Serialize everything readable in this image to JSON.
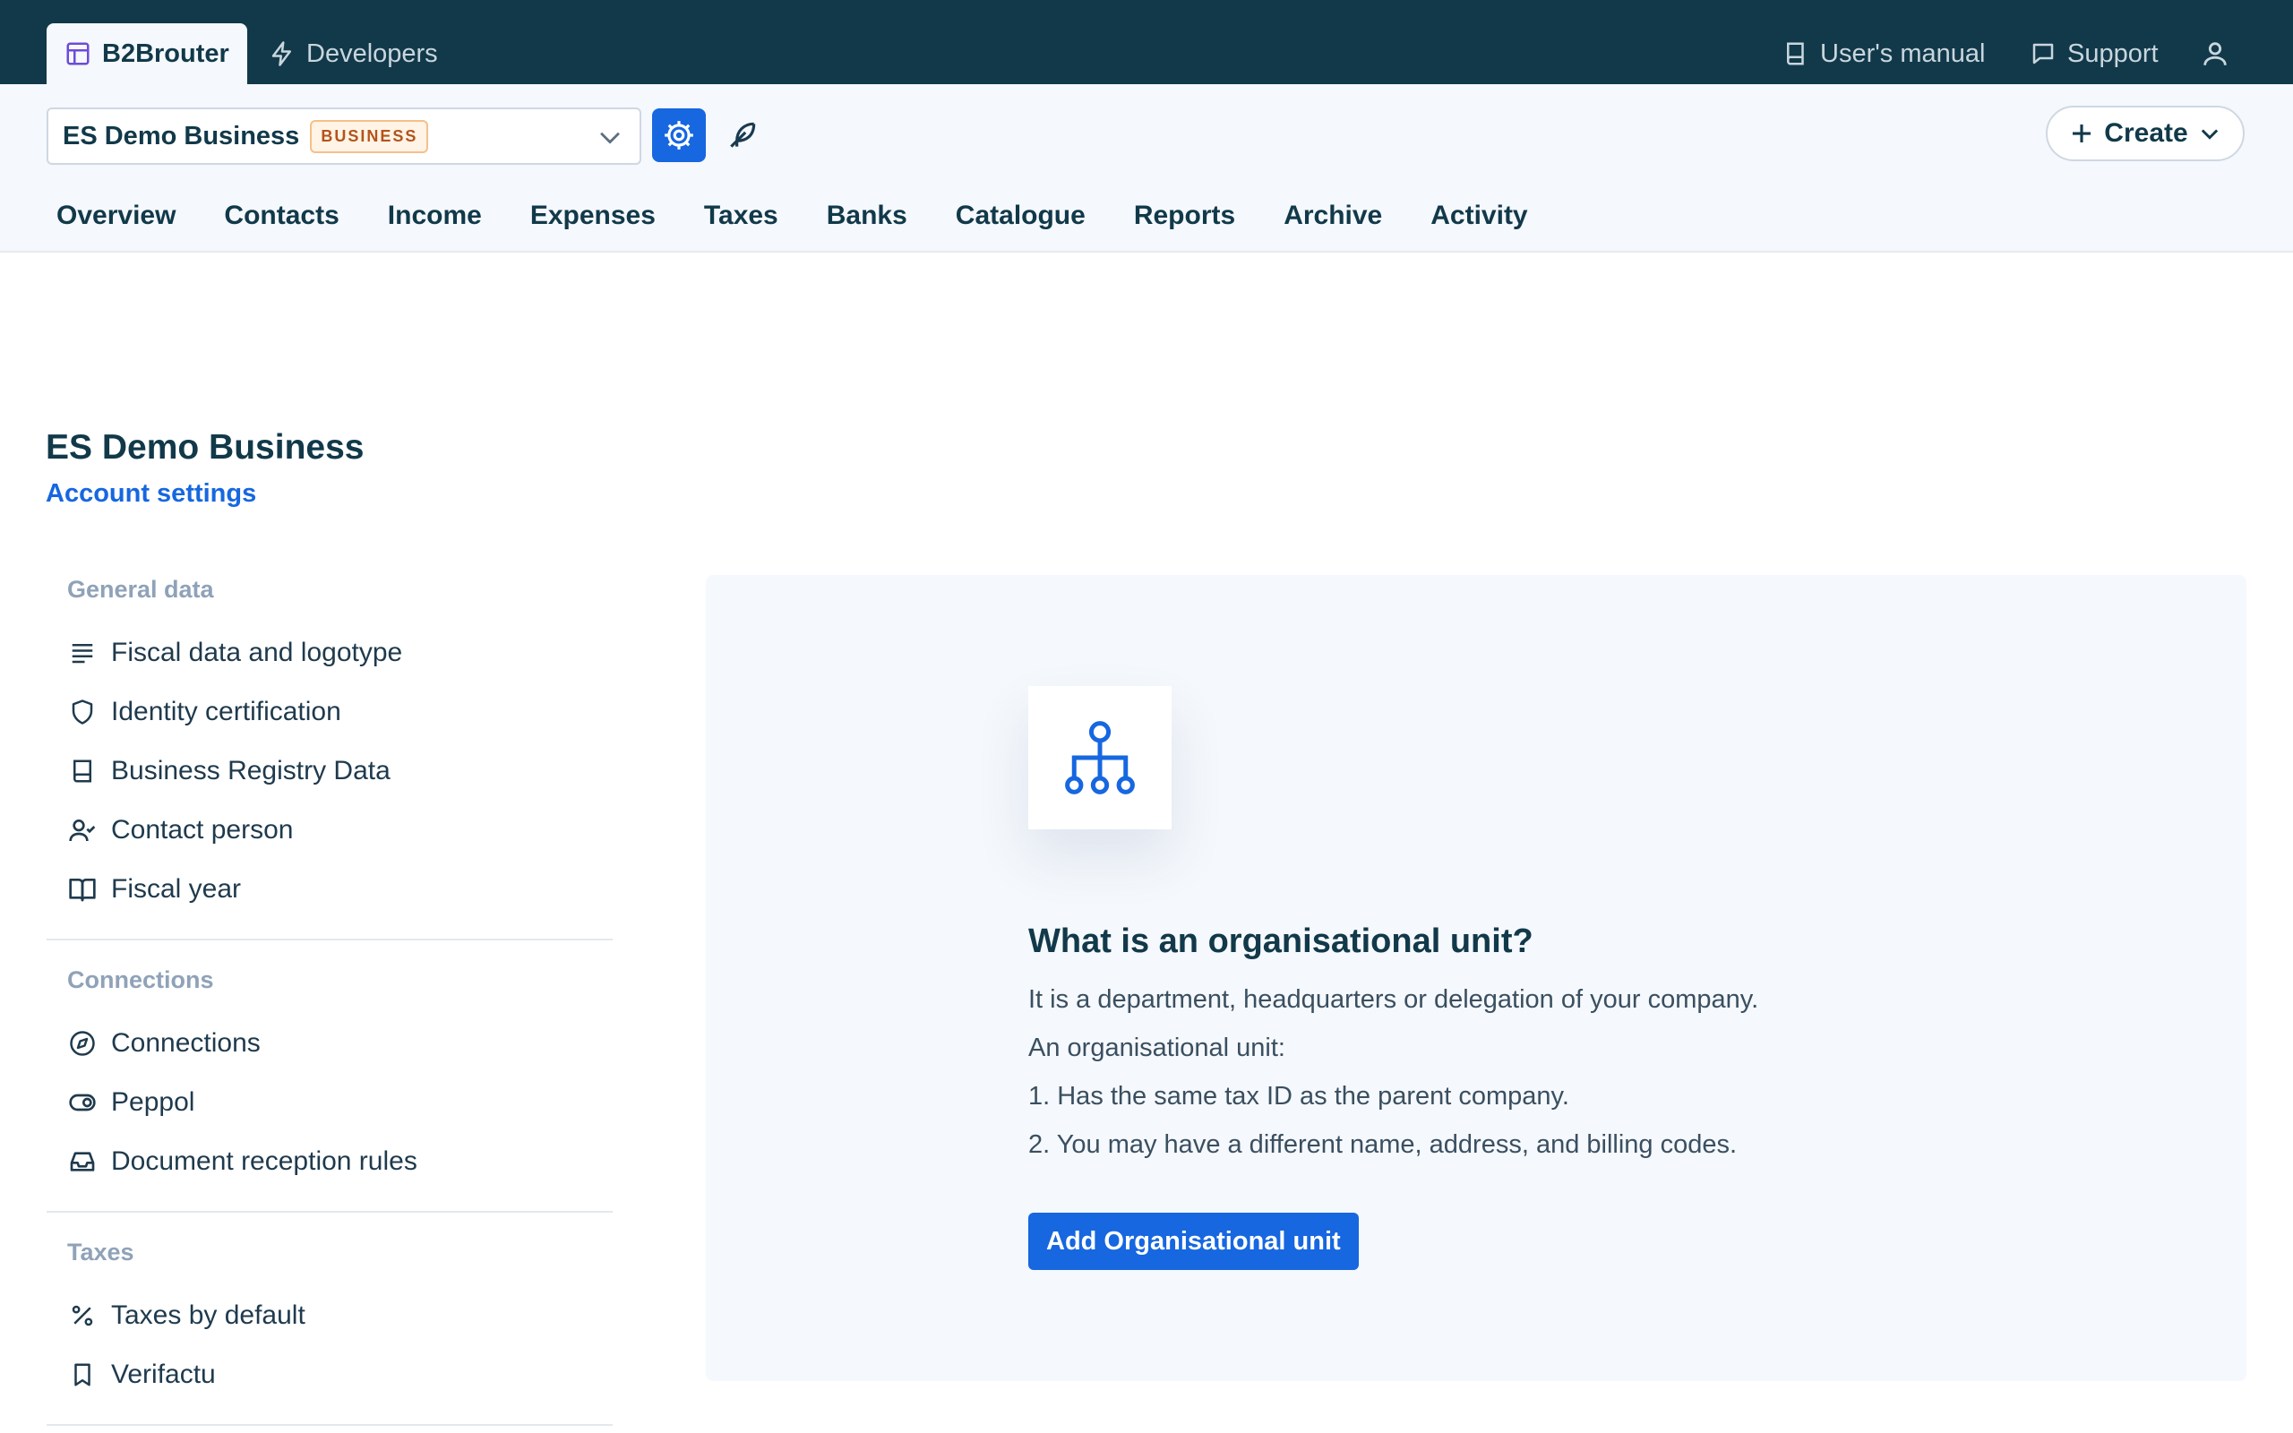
{
  "app_tabs": {
    "active": "B2Brouter",
    "developers": "Developers"
  },
  "top_right": {
    "manual": "User's manual",
    "support": "Support"
  },
  "account_selector": {
    "name": "ES Demo Business",
    "badge": "BUSINESS"
  },
  "create_button": "Create",
  "nav": [
    "Overview",
    "Contacts",
    "Income",
    "Expenses",
    "Taxes",
    "Banks",
    "Catalogue",
    "Reports",
    "Archive",
    "Activity"
  ],
  "page": {
    "title": "ES Demo Business",
    "subtitle": "Account settings"
  },
  "sidebar": {
    "general": {
      "title": "General data",
      "items": [
        "Fiscal data and logotype",
        "Identity certification",
        "Business Registry Data",
        "Contact person",
        "Fiscal year"
      ]
    },
    "connections": {
      "title": "Connections",
      "items": [
        "Connections",
        "Peppol",
        "Document reception rules"
      ]
    },
    "taxes": {
      "title": "Taxes",
      "items": [
        "Taxes by default",
        "Verifactu"
      ]
    }
  },
  "card": {
    "title": "What is an organisational unit?",
    "lines": [
      "It is a department, headquarters or delegation of your company.",
      "An organisational unit:",
      "1. Has the same tax ID as the parent company.",
      "2. You may have a different name, address, and billing codes."
    ],
    "button": "Add Organisational unit"
  },
  "colors": {
    "topbar": "#11394a",
    "accent": "#1667e0",
    "badge_text": "#b4531b",
    "muted": "#8fa2b8"
  },
  "icons": {
    "app": "layout-icon",
    "developers": "bolt-icon",
    "manual": "book-icon",
    "support": "chat-icon",
    "user": "user-icon",
    "settings": "gear-icon",
    "feather": "feather-icon",
    "illustration": "org-chart-icon"
  }
}
